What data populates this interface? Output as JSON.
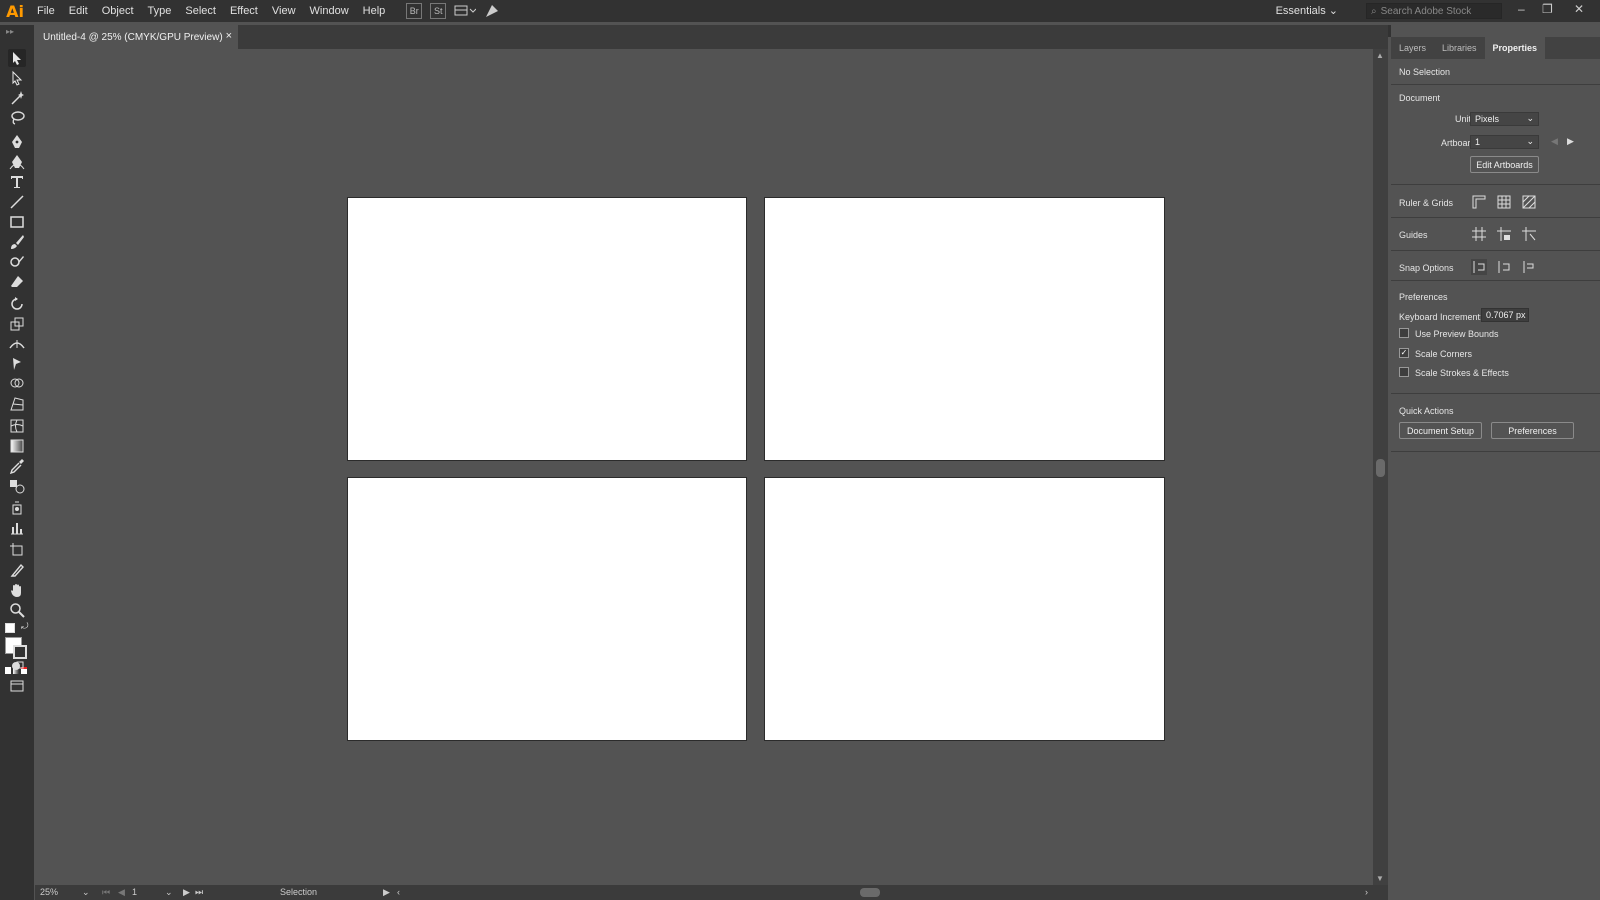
{
  "app": {
    "logo": "Ai"
  },
  "menu": [
    "File",
    "Edit",
    "Object",
    "Type",
    "Select",
    "Effect",
    "View",
    "Window",
    "Help"
  ],
  "menu_icons": {
    "bridge": "Br",
    "stock": "St"
  },
  "workspace": "Essentials",
  "stock_search": {
    "placeholder": "Search Adobe Stock"
  },
  "document_tab": {
    "title": "Untitled-4 @ 25% (CMYK/GPU Preview)",
    "close": "×"
  },
  "status": {
    "zoom": "25%",
    "artboard": "1",
    "tool": "Selection"
  },
  "panel": {
    "tabs": [
      "Layers",
      "Libraries",
      "Properties"
    ],
    "active_tab": "Properties",
    "selection": "No Selection",
    "document_heading": "Document",
    "units_label": "Units:",
    "units_value": "Pixels",
    "artboard_label": "Artboard:",
    "artboard_value": "1",
    "edit_artboards": "Edit Artboards",
    "ruler_grids": "Ruler & Grids",
    "guides": "Guides",
    "snap_options": "Snap Options",
    "preferences_heading": "Preferences",
    "keyboard_increment_label": "Keyboard Increment:",
    "keyboard_increment_value": "0.7067 px",
    "checkboxes": [
      {
        "label": "Use Preview Bounds",
        "checked": false
      },
      {
        "label": "Scale Corners",
        "checked": true
      },
      {
        "label": "Scale Strokes & Effects",
        "checked": false
      }
    ],
    "quick_actions_heading": "Quick Actions",
    "document_setup": "Document Setup",
    "preferences_button": "Preferences"
  },
  "colors": {
    "app_orange": "#ff9a00",
    "chrome_dark": "#323232",
    "canvas": "#535353",
    "artboard": "#ffffff"
  }
}
